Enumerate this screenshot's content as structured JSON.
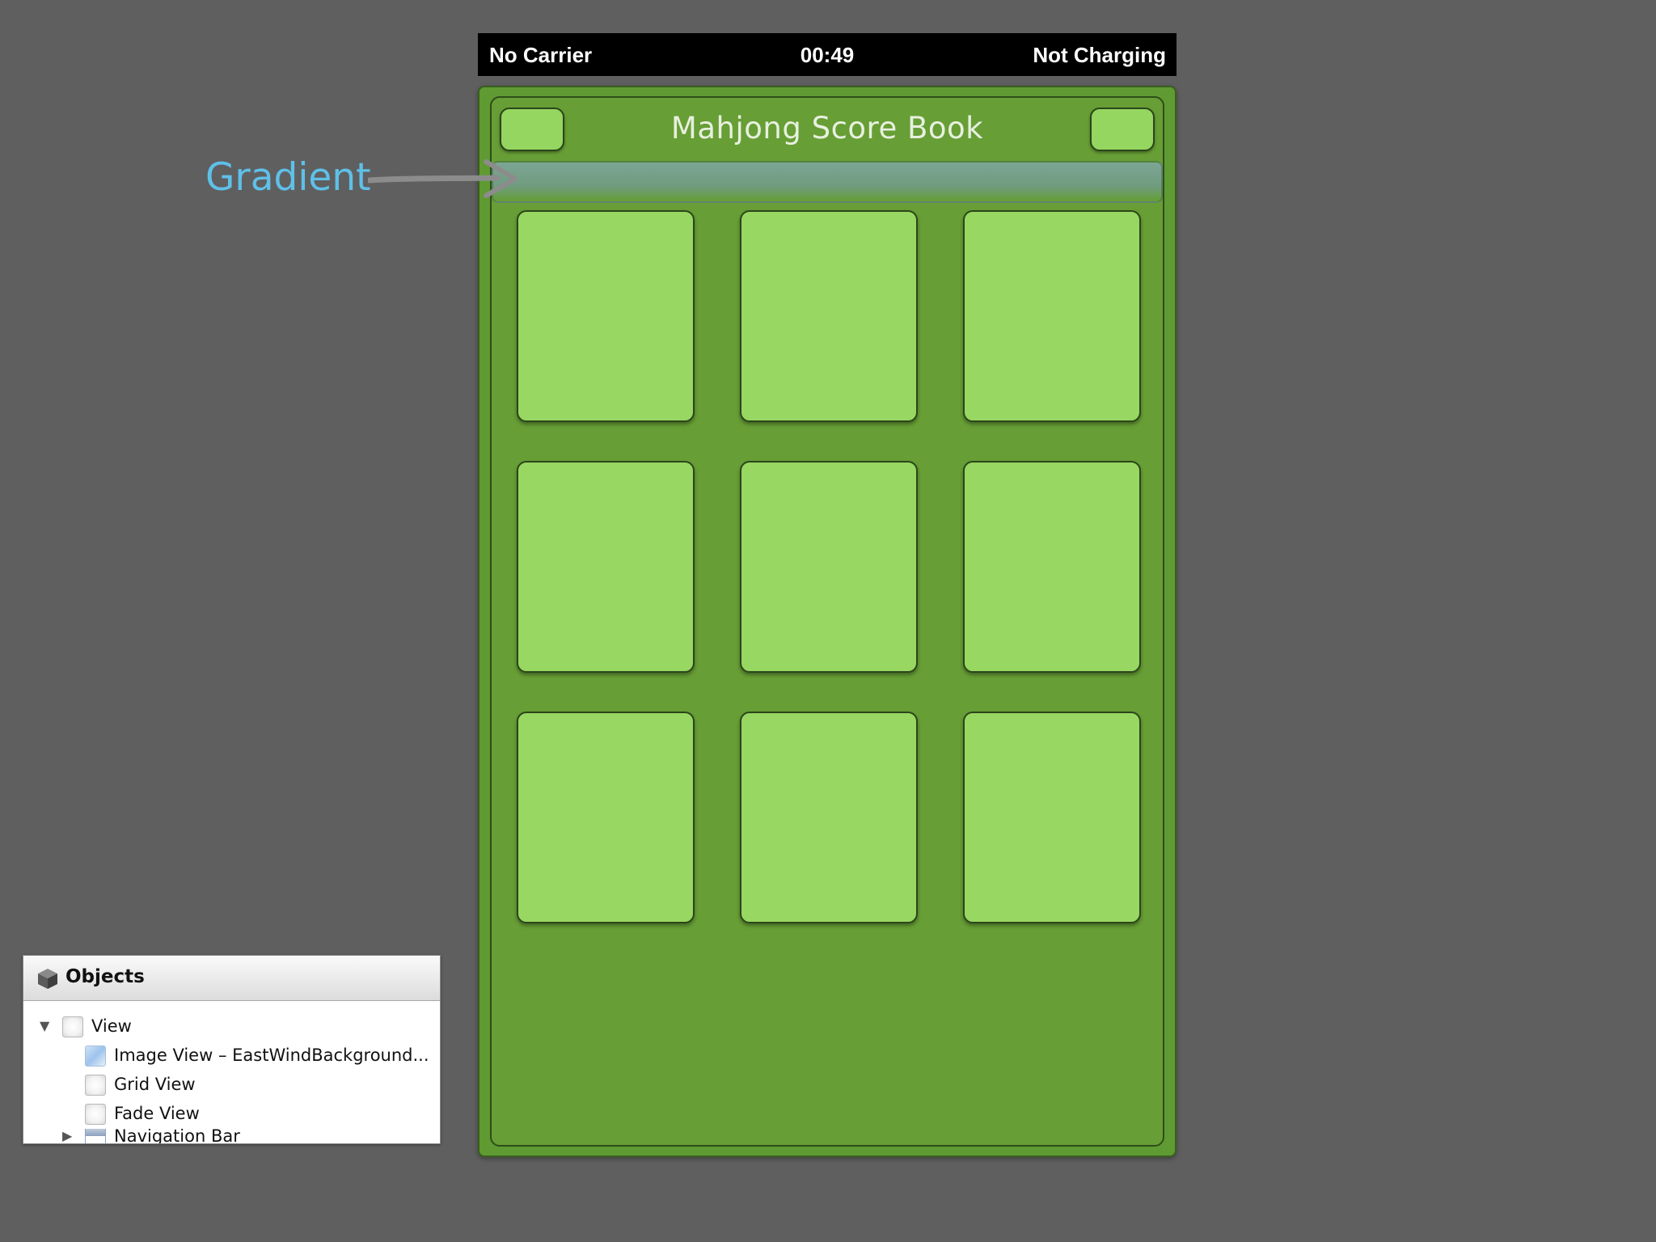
{
  "status_bar": {
    "carrier": "No Carrier",
    "time": "00:49",
    "battery": "Not Charging"
  },
  "nav_bar": {
    "title": "Mahjong Score Book"
  },
  "annotation": {
    "label": "Gradient"
  },
  "grid": {
    "tiles": [
      {
        "row": 0,
        "col": 0
      },
      {
        "row": 0,
        "col": 1
      },
      {
        "row": 0,
        "col": 2
      },
      {
        "row": 1,
        "col": 0
      },
      {
        "row": 1,
        "col": 1
      },
      {
        "row": 1,
        "col": 2
      },
      {
        "row": 2,
        "col": 0
      },
      {
        "row": 2,
        "col": 1
      },
      {
        "row": 2,
        "col": 2
      }
    ]
  },
  "objects_panel": {
    "title": "Objects",
    "items": [
      {
        "label": "View",
        "icon": "view-icon",
        "expanded": true
      },
      {
        "label": "Image View – EastWindBackground...",
        "icon": "image-view-icon"
      },
      {
        "label": "Grid View",
        "icon": "view-icon"
      },
      {
        "label": "Fade View",
        "icon": "view-icon"
      },
      {
        "label": "Navigation Bar",
        "icon": "navigation-bar-icon",
        "expanded": false
      }
    ]
  },
  "colors": {
    "background": "#5f5f60",
    "frame_green": "#679e35",
    "tile_green": "#98d762",
    "annotation_blue": "#5fc0e8"
  }
}
